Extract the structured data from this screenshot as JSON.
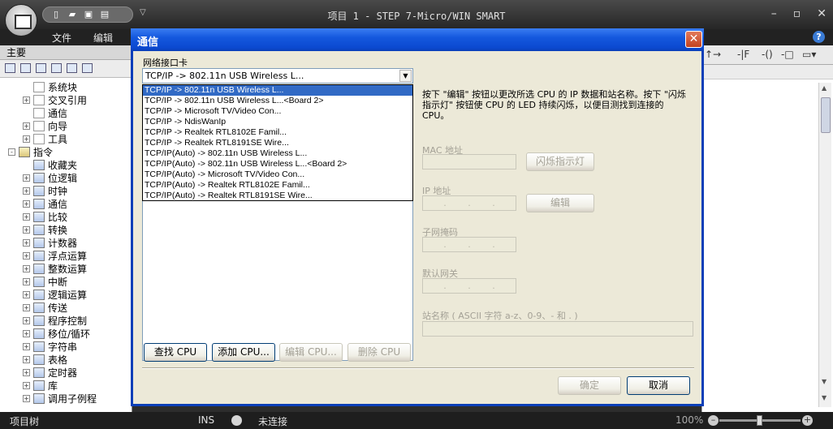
{
  "app": {
    "title": "项目 1 - STEP 7-Micro/WIN SMART",
    "menu": [
      "文件",
      "编辑"
    ],
    "qat_icons": [
      "new-icon",
      "open-icon",
      "save-icon",
      "print-icon"
    ]
  },
  "left_panel": {
    "title": "主要",
    "tree": [
      {
        "label": "系统块",
        "indent": 2,
        "icon": "system-block-icon",
        "expander": ""
      },
      {
        "label": "交叉引用",
        "indent": 2,
        "icon": "cross-reference-icon",
        "expander": "+"
      },
      {
        "label": "通信",
        "indent": 2,
        "icon": "communication-icon",
        "expander": ""
      },
      {
        "label": "向导",
        "indent": 2,
        "icon": "wizard-icon",
        "expander": "+"
      },
      {
        "label": "工具",
        "indent": 2,
        "icon": "tools-icon",
        "expander": "+"
      },
      {
        "label": "指令",
        "indent": 1,
        "icon": "instructions-icon",
        "expander": "-"
      },
      {
        "label": "收藏夹",
        "indent": 2,
        "icon": "favorites-icon",
        "expander": ""
      },
      {
        "label": "位逻辑",
        "indent": 2,
        "icon": "bit-logic-icon",
        "expander": "+"
      },
      {
        "label": "时钟",
        "indent": 2,
        "icon": "clock-icon",
        "expander": "+"
      },
      {
        "label": "通信",
        "indent": 2,
        "icon": "communication-icon",
        "expander": "+"
      },
      {
        "label": "比较",
        "indent": 2,
        "icon": "compare-icon",
        "expander": "+"
      },
      {
        "label": "转换",
        "indent": 2,
        "icon": "convert-icon",
        "expander": "+"
      },
      {
        "label": "计数器",
        "indent": 2,
        "icon": "counter-icon",
        "expander": "+"
      },
      {
        "label": "浮点运算",
        "indent": 2,
        "icon": "float-math-icon",
        "expander": "+"
      },
      {
        "label": "整数运算",
        "indent": 2,
        "icon": "integer-math-icon",
        "expander": "+"
      },
      {
        "label": "中断",
        "indent": 2,
        "icon": "interrupt-icon",
        "expander": "+"
      },
      {
        "label": "逻辑运算",
        "indent": 2,
        "icon": "logic-ops-icon",
        "expander": "+"
      },
      {
        "label": "传送",
        "indent": 2,
        "icon": "move-icon",
        "expander": "+"
      },
      {
        "label": "程序控制",
        "indent": 2,
        "icon": "program-control-icon",
        "expander": "+"
      },
      {
        "label": "移位/循环",
        "indent": 2,
        "icon": "shift-rotate-icon",
        "expander": "+"
      },
      {
        "label": "字符串",
        "indent": 2,
        "icon": "string-icon",
        "expander": "+"
      },
      {
        "label": "表格",
        "indent": 2,
        "icon": "table-icon",
        "expander": "+"
      },
      {
        "label": "定时器",
        "indent": 2,
        "icon": "timer-icon",
        "expander": "+"
      },
      {
        "label": "库",
        "indent": 2,
        "icon": "library-icon",
        "expander": "+"
      },
      {
        "label": "调用子例程",
        "indent": 2,
        "icon": "call-subroutine-icon",
        "expander": "+"
      }
    ]
  },
  "dialog": {
    "title": "通信",
    "nic_label": "网络接口卡",
    "nic_selected": "TCP/IP -> 802.11n USB Wireless L...",
    "nic_options": [
      "TCP/IP -> 802.11n USB Wireless L...",
      "TCP/IP -> 802.11n USB Wireless L...<Board 2>",
      "TCP/IP -> Microsoft TV/Video Con...",
      "TCP/IP -> NdisWanIp",
      "TCP/IP -> Realtek RTL8102E Famil...",
      "TCP/IP -> Realtek RTL8191SE Wire...",
      "TCP/IP(Auto) -> 802.11n USB Wireless L...",
      "TCP/IP(Auto) -> 802.11n USB Wireless L...<Board 2>",
      "TCP/IP(Auto) -> Microsoft TV/Video Con...",
      "TCP/IP(Auto) -> Realtek RTL8102E Famil...",
      "TCP/IP(Auto) -> Realtek RTL8191SE Wire..."
    ],
    "description": "按下 \"编辑\" 按钮以更改所选 CPU 的 IP 数据和站名称。按下 \"闪烁指示灯\" 按钮使 CPU 的 LED 持续闪烁，以便目测找到连接的 CPU。",
    "mac_label": "MAC 地址",
    "blink_button": "闪烁指示灯",
    "ip_label": "IP 地址",
    "edit_button": "编辑",
    "subnet_label": "子网掩码",
    "gateway_label": "默认网关",
    "station_label": "站名称 ( ASCII 字符 a-z、0-9、- 和 . )",
    "find_cpu": "查找 CPU",
    "add_cpu": "添加 CPU...",
    "edit_cpu": "编辑 CPU...",
    "delete_cpu": "删除 CPU",
    "ok": "确定",
    "cancel": "取消"
  },
  "status_bar": {
    "project_tree": "项目树",
    "ins": "INS",
    "connection": "未连接",
    "zoom": "100%"
  }
}
